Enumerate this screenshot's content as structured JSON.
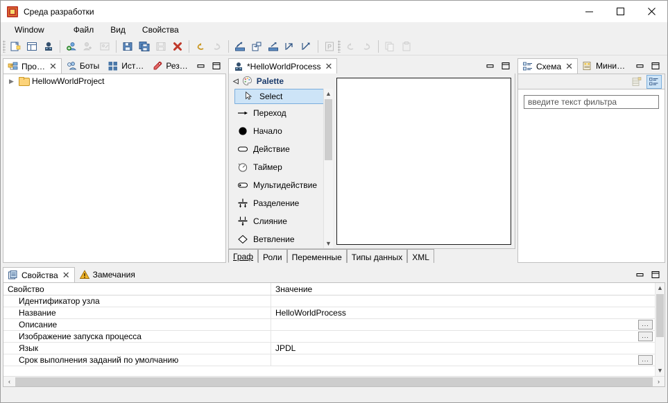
{
  "window": {
    "title": "Среда разработки",
    "app_icon": "app-logo-icon",
    "minimize": "–",
    "maximize": "□",
    "close": "✕"
  },
  "menubar": {
    "items": [
      {
        "label": "Window"
      },
      {
        "label": "Файл"
      },
      {
        "label": "Вид"
      },
      {
        "label": "Свойства"
      }
    ]
  },
  "toolbar": {
    "groups": [
      {
        "buttons": [
          {
            "name": "new-file-icon",
            "enabled": true
          },
          {
            "name": "new-form-icon",
            "enabled": true
          },
          {
            "name": "new-process-icon",
            "enabled": true
          }
        ]
      },
      {
        "buttons": [
          {
            "name": "users-group-icon",
            "enabled": true
          },
          {
            "name": "add-user-icon",
            "enabled": false
          },
          {
            "name": "edit-permissions-icon",
            "enabled": false
          }
        ]
      },
      {
        "buttons": [
          {
            "name": "save-icon",
            "enabled": true
          },
          {
            "name": "save-all-icon",
            "enabled": true
          },
          {
            "name": "save-as-icon",
            "enabled": false
          },
          {
            "name": "delete-icon",
            "enabled": true
          }
        ]
      },
      {
        "buttons": [
          {
            "name": "undo-arrow-icon",
            "enabled": true
          },
          {
            "name": "redo-arrow-icon",
            "enabled": false
          }
        ]
      },
      {
        "buttons": [
          {
            "name": "import-icon",
            "enabled": true
          },
          {
            "name": "import-archive-icon",
            "enabled": true
          },
          {
            "name": "export-icon",
            "enabled": true
          },
          {
            "name": "import-file-icon",
            "enabled": true
          },
          {
            "name": "export-file-icon",
            "enabled": true
          }
        ]
      },
      {
        "buttons": [
          {
            "name": "pdf-export-icon",
            "enabled": false
          }
        ]
      },
      {
        "buttons": [
          {
            "name": "undo-icon",
            "enabled": false
          },
          {
            "name": "redo-icon",
            "enabled": false
          }
        ]
      },
      {
        "buttons": [
          {
            "name": "copy-icon",
            "enabled": false
          },
          {
            "name": "paste-icon",
            "enabled": false
          }
        ]
      }
    ]
  },
  "explorer": {
    "tabs": [
      {
        "label": "Про…",
        "icon": "project-explorer-icon",
        "active": true,
        "closable": true
      },
      {
        "label": "Боты",
        "icon": "bots-icon",
        "active": false,
        "closable": false
      },
      {
        "label": "Ист…",
        "icon": "datasource-icon",
        "active": false,
        "closable": false
      },
      {
        "label": "Рез…",
        "icon": "result-icon",
        "active": false,
        "closable": false
      }
    ],
    "tree": [
      {
        "label": "HellowWorldProject",
        "expanded": false,
        "icon": "folder-icon"
      }
    ],
    "minimize": "minimize-icon",
    "maximize": "maximize-icon"
  },
  "editor": {
    "tab": {
      "label": "*HelloWorldProcess",
      "icon": "process-icon",
      "closable": true
    },
    "minimize": "minimize-icon",
    "maximize": "maximize-icon",
    "palette": {
      "title": "Palette",
      "collapse_icon": "collapse-left-icon",
      "icon": "palette-icon",
      "items": [
        {
          "label": "Select",
          "icon": "cursor-icon",
          "selected": true
        },
        {
          "label": "Переход",
          "icon": "transition-arrow-icon",
          "selected": false
        },
        {
          "label": "Начало",
          "icon": "start-node-icon",
          "selected": false
        },
        {
          "label": "Действие",
          "icon": "action-node-icon",
          "selected": false
        },
        {
          "label": "Таймер",
          "icon": "timer-node-icon",
          "selected": false
        },
        {
          "label": "Мультидействие",
          "icon": "multi-action-icon",
          "selected": false
        },
        {
          "label": "Разделение",
          "icon": "fork-icon",
          "selected": false
        },
        {
          "label": "Слияние",
          "icon": "join-icon",
          "selected": false
        },
        {
          "label": "Ветвление",
          "icon": "decision-icon",
          "selected": false
        }
      ]
    },
    "bottom_tabs": [
      {
        "label": "Граф",
        "active": true
      },
      {
        "label": "Роли",
        "active": false
      },
      {
        "label": "Переменные",
        "active": false
      },
      {
        "label": "Типы данных",
        "active": false
      },
      {
        "label": "XML",
        "active": false
      }
    ]
  },
  "outline": {
    "tabs": [
      {
        "label": "Схема",
        "icon": "outline-icon",
        "active": true,
        "closable": true
      },
      {
        "label": "Мини…",
        "icon": "minimap-icon",
        "active": false,
        "closable": false
      }
    ],
    "minimize": "minimize-icon",
    "maximize": "maximize-icon",
    "toolbar": [
      {
        "name": "flat-list-view-icon",
        "selected": false
      },
      {
        "name": "tree-view-icon",
        "selected": true
      }
    ],
    "filter": {
      "placeholder": "введите текст фильтра",
      "value": ""
    }
  },
  "properties": {
    "tabs": [
      {
        "label": "Свойства",
        "icon": "properties-icon",
        "active": true,
        "closable": true
      },
      {
        "label": "Замечания",
        "icon": "warning-icon",
        "active": false,
        "closable": false
      }
    ],
    "minimize": "minimize-icon",
    "maximize": "maximize-icon",
    "columns": [
      "Свойство",
      "Значение"
    ],
    "rows": [
      {
        "name": "Идентификатор узла",
        "value": "",
        "has_button": false
      },
      {
        "name": "Название",
        "value": "HelloWorldProcess",
        "has_button": false
      },
      {
        "name": "Описание",
        "value": "",
        "has_button": true
      },
      {
        "name": "Изображение запуска процесса",
        "value": "",
        "has_button": true
      },
      {
        "name": "Язык",
        "value": "JPDL",
        "has_button": false
      },
      {
        "name": "Срок выполнения заданий по умолчанию",
        "value": "",
        "has_button": true
      }
    ],
    "dots_label": "...",
    "scroll_left_arrow": "‹",
    "scroll_right_arrow": "›"
  }
}
